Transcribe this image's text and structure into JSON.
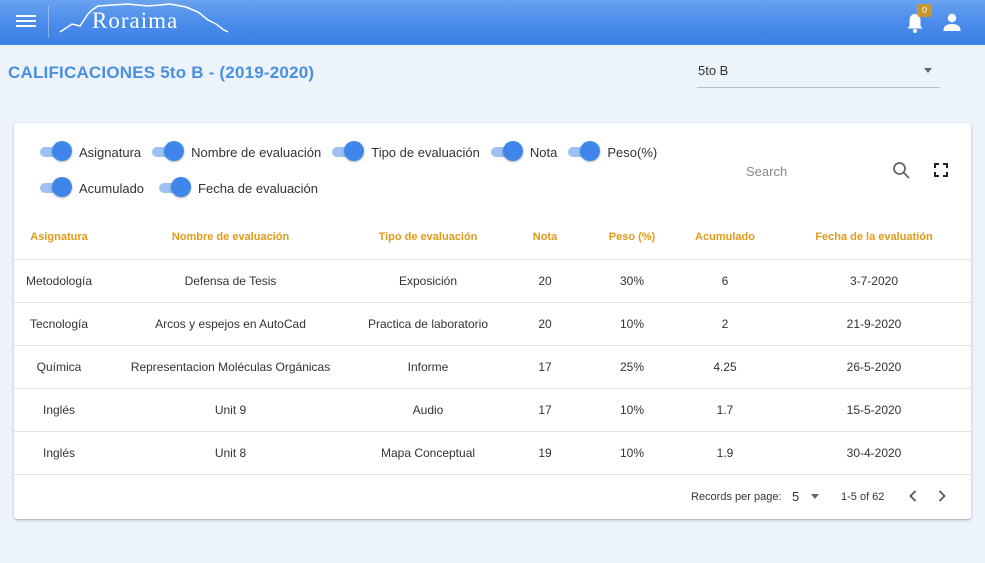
{
  "topbar": {
    "logo_text": "Roraima",
    "notification_count": "0"
  },
  "page": {
    "title": "CALIFICACIONES 5to B - (2019-2020)"
  },
  "group_select": {
    "selected": "5to B"
  },
  "toggles": [
    {
      "label": "Asignatura",
      "on": true
    },
    {
      "label": "Nombre de evaluación",
      "on": true
    },
    {
      "label": "Tipo de evaluación",
      "on": true
    },
    {
      "label": "Nota",
      "on": true
    },
    {
      "label": "Peso(%)",
      "on": true
    },
    {
      "label": "Acumulado",
      "on": true
    },
    {
      "label": "Fecha de evaluación",
      "on": true
    }
  ],
  "search": {
    "placeholder": "Search"
  },
  "table": {
    "headers": [
      "Asignatura",
      "Nombre de evaluación",
      "Tipo de evaluación",
      "Nota",
      "Peso (%)",
      "Acumulado",
      "Fecha de la evaluatión"
    ],
    "rows": [
      [
        "Metodología",
        "Defensa de Tesis",
        "Exposición",
        "20",
        "30%",
        "6",
        "3-7-2020"
      ],
      [
        "Tecnología",
        "Arcos y espejos en AutoCad",
        "Practica de laboratorio",
        "20",
        "10%",
        "2",
        "21-9-2020"
      ],
      [
        "Química",
        "Representacion Moléculas Orgánicas",
        "Informe",
        "17",
        "25%",
        "4.25",
        "26-5-2020"
      ],
      [
        "Inglés",
        "Unit 9",
        "Audio",
        "17",
        "10%",
        "1.7",
        "15-5-2020"
      ],
      [
        "Inglés",
        "Unit 8",
        "Mapa Conceptual",
        "19",
        "10%",
        "1.9",
        "30-4-2020"
      ]
    ]
  },
  "pagination": {
    "records_per_page_label": "Records per page:",
    "records_per_page": "5",
    "range": "1-5 of 62"
  },
  "colors": {
    "primary": "#3f86eb",
    "header_text": "#e39a16",
    "title": "#4a8fe0"
  }
}
